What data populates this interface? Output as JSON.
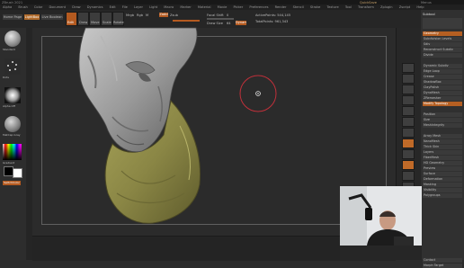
{
  "titlebar": {
    "left": "ZBrush 2021",
    "center": "",
    "right_user": "QuickSave",
    "right_menu": "Menus"
  },
  "menubar": [
    "Alpha",
    "Brush",
    "Color",
    "Document",
    "Draw",
    "Dynamics",
    "Edit",
    "File",
    "Layer",
    "Light",
    "Macro",
    "Marker",
    "Material",
    "Movie",
    "Picker",
    "Preferences",
    "Render",
    "Stencil",
    "Stroke",
    "Texture",
    "Tool",
    "Transform",
    "Zplugin",
    "Zscript",
    "Help"
  ],
  "topshelf": {
    "home_page": "Home Page",
    "lightbox": "LightBox",
    "live_boolean": "Live Boolean",
    "edit": "Edit",
    "draw": "Draw",
    "move": "Move",
    "scale": "Scale",
    "rotate": "Rotate",
    "mrgb": "Mrgb",
    "rgb": "Rgb",
    "m": "M",
    "zadd": "Zadd",
    "zsub": "Zsub",
    "focal_shift_label": "Focal Shift",
    "focal_shift_value": "0",
    "draw_size_label": "Draw Size",
    "draw_size_value": "64",
    "dynamic": "Dynamic",
    "active_points": "ActivePoints: 544,145",
    "total_points": "TotalPoints: 961,343"
  },
  "left_tray": {
    "brush_label": "Standard",
    "stroke_label": "Dots",
    "alpha_label": "Alpha Off",
    "texture_label": "Texture Off",
    "material_label": "MatCap Gray",
    "gradient_label": "Gradient",
    "switch_color": "SwitchColor"
  },
  "right_panel": {
    "header": "Subtool",
    "rows": [
      "Geometry",
      "Subdivision Levels",
      "Sdiv",
      "Reconstruct Subdiv",
      "Divide",
      "Dynamic Subdiv",
      "Edge Loop",
      "Crease",
      "ShadowBox",
      "ClayPolish",
      "DynaMesh",
      "ZRemesher",
      "Modify Topology",
      "Position",
      "Size",
      "MeshIntegrity",
      "Array Mesh",
      "NanoMesh",
      "Thick Skin",
      "Layers",
      "FiberMesh",
      "HD Geometry",
      "Preview",
      "Surface",
      "Deformation",
      "Masking",
      "Visibility",
      "Polygroups",
      "Contact",
      "Morph Target"
    ],
    "orange_rows": [
      "Modify Topology"
    ]
  },
  "colors": {
    "accent": "#c06a28",
    "model_clay": "#9a9a9a",
    "cloth": "#8a8a45",
    "brush_ring": "#c0303a",
    "canvas_bg": "#2b2b2b"
  },
  "icons": [
    "brush-icon",
    "stroke-icon",
    "alpha-icon",
    "material-sphere-icon",
    "color-picker-icon",
    "rotate-cursor-icon"
  ]
}
